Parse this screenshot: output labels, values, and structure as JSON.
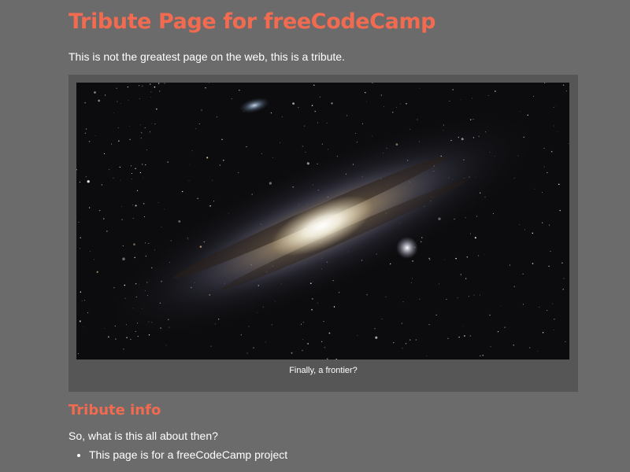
{
  "header": {
    "title": "Tribute Page for freeCodeCamp"
  },
  "intro": {
    "tagline": "This is not the greatest page on the web, this is a tribute."
  },
  "figure": {
    "image_subject": "andromeda-galaxy",
    "caption": "Finally, a frontier?"
  },
  "info": {
    "heading": "Tribute info",
    "question": "So, what is this all about then?",
    "bullets": [
      "This page is for a freeCodeCamp project"
    ]
  },
  "colors": {
    "background": "#6b6b6b",
    "figure_background": "#565656",
    "accent": "#f26b50",
    "text": "#ffffff"
  }
}
